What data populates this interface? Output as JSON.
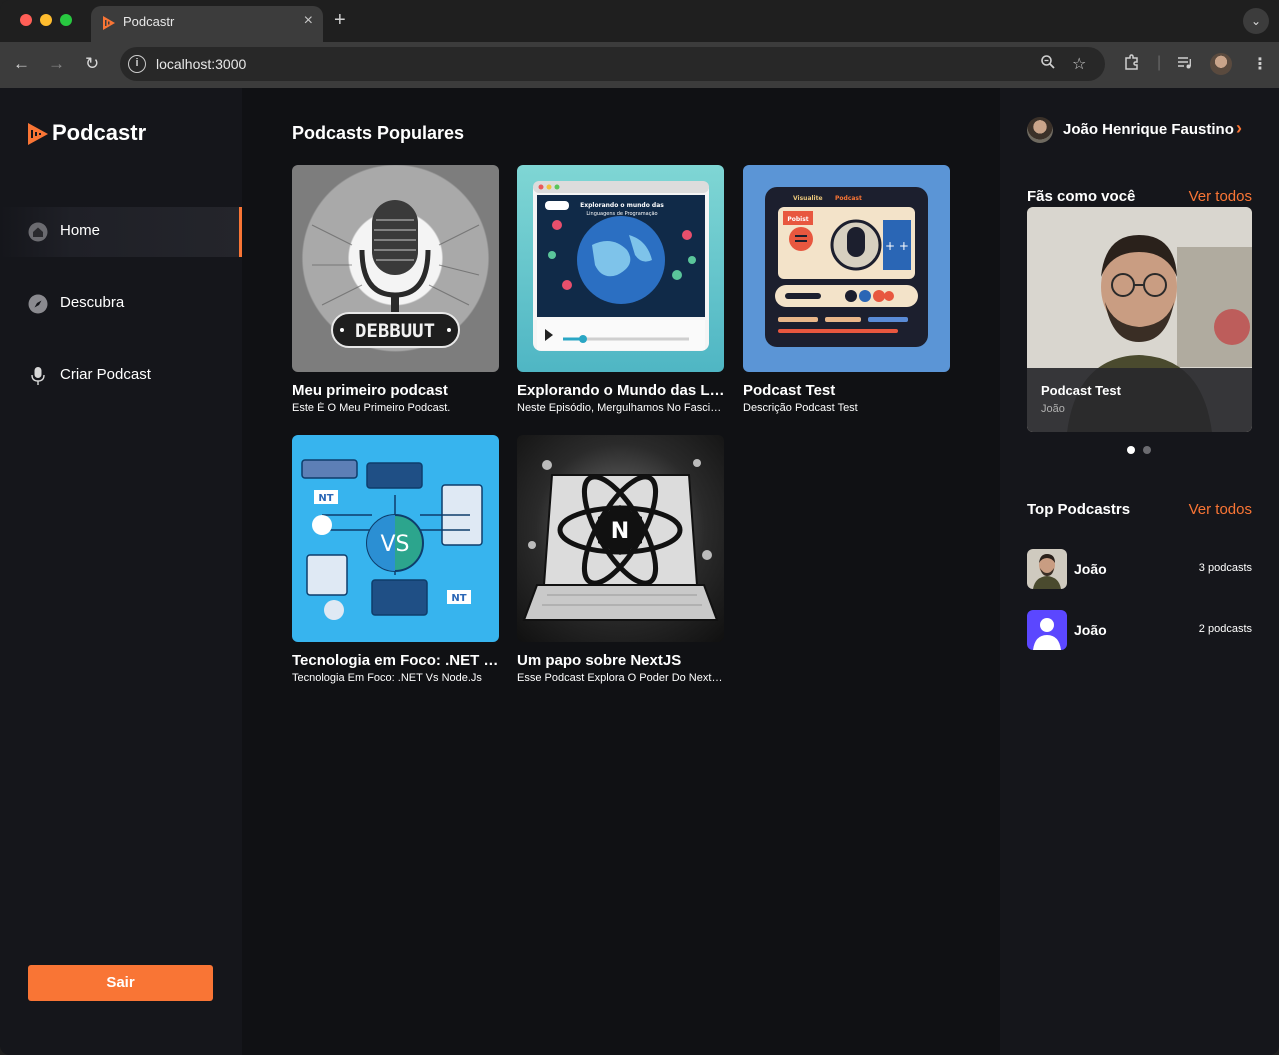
{
  "browser": {
    "tab_title": "Podcastr",
    "url": "localhost:3000"
  },
  "app": {
    "logo_text": "Podcastr",
    "nav": [
      {
        "label": "Home",
        "icon": "home-icon",
        "active": true
      },
      {
        "label": "Descubra",
        "icon": "compass-icon",
        "active": false
      },
      {
        "label": "Criar Podcast",
        "icon": "microphone-icon",
        "active": false
      }
    ],
    "logout_label": "Sair",
    "accent_color": "#f97535"
  },
  "main": {
    "section_title": "Podcasts Populares",
    "podcasts": [
      {
        "title": "Meu primeiro podcast",
        "description": "Este É O Meu Primeiro Podcast.",
        "cover_text": "DEBBUUT"
      },
      {
        "title": "Explorando o Mundo das Linguagens de Programação",
        "description": "Neste Episódio, Mergulhamos No Fascinante Mundo Das Linguagens",
        "cover_text": "Explorando o mundo das Linguagens de Programação"
      },
      {
        "title": "Podcast Test",
        "description": "Descrição Podcast Test",
        "cover_text": "Podcast"
      },
      {
        "title": "Tecnologia em Foco: .NET vs Node.Js",
        "description": "Tecnologia Em Foco: .NET Vs Node.Js",
        "cover_text": "VS"
      },
      {
        "title": "Um papo sobre NextJS",
        "description": "Esse Podcast Explora O Poder Do Next.JS",
        "cover_text": "N"
      }
    ]
  },
  "right": {
    "profile_name": "João Henrique Faustino",
    "fans_heading": "Fãs como você",
    "fans_link": "Ver todos",
    "fan_card": {
      "title": "Podcast Test",
      "author": "João"
    },
    "top_heading": "Top Podcastrs",
    "top_link": "Ver todos",
    "top_podcasters": [
      {
        "name": "João",
        "count": "3 podcasts"
      },
      {
        "name": "João",
        "count": "2 podcasts"
      }
    ]
  }
}
